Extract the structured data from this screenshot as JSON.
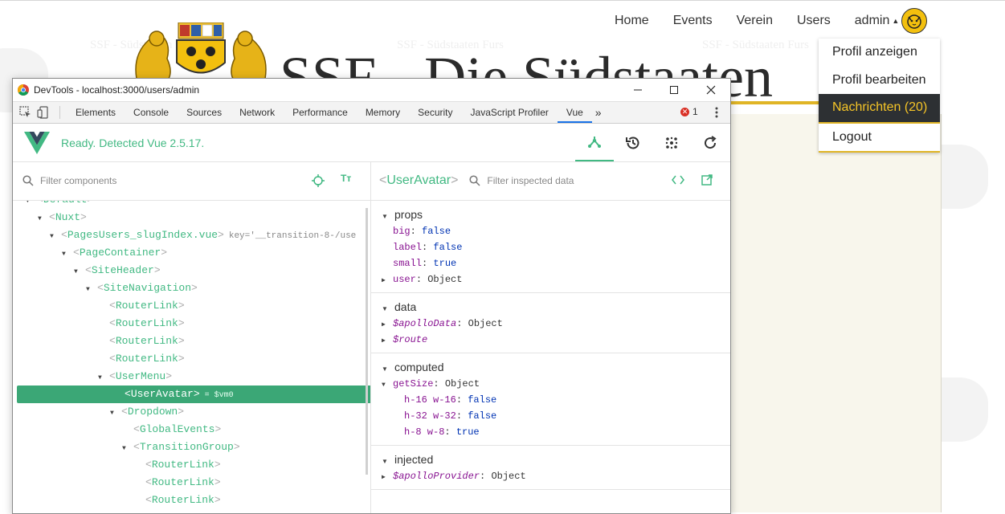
{
  "site": {
    "title": "SSF - Die Südstaaten",
    "watermark": "SSF - Südstaaten Furs",
    "nav": [
      "Home",
      "Events",
      "Verein",
      "Users"
    ],
    "user_label": "admin",
    "dropdown": [
      {
        "label": "Profil anzeigen",
        "active": false
      },
      {
        "label": "Profil bearbeiten",
        "active": false
      },
      {
        "label": "Nachrichten (20)",
        "active": true
      },
      {
        "label": "Logout",
        "active": false
      }
    ],
    "colors": {
      "accent": "#e0b526",
      "dark": "#2d3033",
      "panel": "#f8f6ec"
    }
  },
  "devtools": {
    "window_title": "DevTools - localhost:3000/users/admin",
    "tabs": [
      "Elements",
      "Console",
      "Sources",
      "Network",
      "Performance",
      "Memory",
      "Security",
      "JavaScript Profiler",
      "Vue"
    ],
    "active_tab": "Vue",
    "more_tabs": "»",
    "error_count": "1",
    "vue": {
      "status": "Ready. Detected Vue 2.5.17.",
      "component_filter_placeholder": "Filter components",
      "format_toggle": "Tт",
      "inspected_component": "UserAvatar",
      "data_filter_placeholder": "Filter inspected data",
      "tree": [
        {
          "name": "Default",
          "depth": 1,
          "arrow": "▼"
        },
        {
          "name": "Nuxt",
          "depth": 2,
          "arrow": "▼"
        },
        {
          "name": "PagesUsers_slugIndex.vue",
          "depth": 3,
          "arrow": "▼",
          "key": "key='__transition-8-/use"
        },
        {
          "name": "PageContainer",
          "depth": 4,
          "arrow": "▼"
        },
        {
          "name": "SiteHeader",
          "depth": 5,
          "arrow": "▼"
        },
        {
          "name": "SiteNavigation",
          "depth": 6,
          "arrow": "▼"
        },
        {
          "name": "RouterLink",
          "depth": 7,
          "arrow": ""
        },
        {
          "name": "RouterLink",
          "depth": 7,
          "arrow": ""
        },
        {
          "name": "RouterLink",
          "depth": 7,
          "arrow": ""
        },
        {
          "name": "RouterLink",
          "depth": 7,
          "arrow": ""
        },
        {
          "name": "UserMenu",
          "depth": 7,
          "arrow": "▼"
        },
        {
          "name": "UserAvatar",
          "depth": 8,
          "arrow": "",
          "selected": true,
          "vm": "= $vm0"
        },
        {
          "name": "Dropdown",
          "depth": 8,
          "arrow": "▼"
        },
        {
          "name": "GlobalEvents",
          "depth": 9,
          "arrow": ""
        },
        {
          "name": "TransitionGroup",
          "depth": 9,
          "arrow": "▼"
        },
        {
          "name": "RouterLink",
          "depth": 10,
          "arrow": ""
        },
        {
          "name": "RouterLink",
          "depth": 10,
          "arrow": ""
        },
        {
          "name": "RouterLink",
          "depth": 10,
          "arrow": ""
        }
      ],
      "sections": [
        {
          "title": "props",
          "items": [
            {
              "key": "big",
              "value": "false",
              "type": "bool",
              "indent": 1
            },
            {
              "key": "label",
              "value": "false",
              "type": "bool",
              "indent": 1
            },
            {
              "key": "small",
              "value": "true",
              "type": "bool",
              "indent": 1
            },
            {
              "key": "user",
              "value": "Object",
              "type": "obj",
              "indent": 1,
              "expandable": true
            }
          ]
        },
        {
          "title": "data",
          "items": [
            {
              "key": "$apolloData",
              "value": "Object",
              "type": "obj",
              "indent": 1,
              "expandable": true,
              "italic": true
            },
            {
              "key": "$route",
              "value": "",
              "type": "obj",
              "indent": 1,
              "expandable": true,
              "italic": true
            }
          ]
        },
        {
          "title": "computed",
          "items": [
            {
              "key": "getSize",
              "value": "Object",
              "type": "obj",
              "indent": 1,
              "expanded": true
            },
            {
              "key": "h-16 w-16",
              "value": "false",
              "type": "bool",
              "indent": 2
            },
            {
              "key": "h-32 w-32",
              "value": "false",
              "type": "bool",
              "indent": 2
            },
            {
              "key": "h-8 w-8",
              "value": "true",
              "type": "bool",
              "indent": 2
            }
          ]
        },
        {
          "title": "injected",
          "items": [
            {
              "key": "$apolloProvider",
              "value": "Object",
              "type": "obj",
              "indent": 1,
              "expandable": true,
              "italic": true
            }
          ]
        }
      ]
    }
  }
}
